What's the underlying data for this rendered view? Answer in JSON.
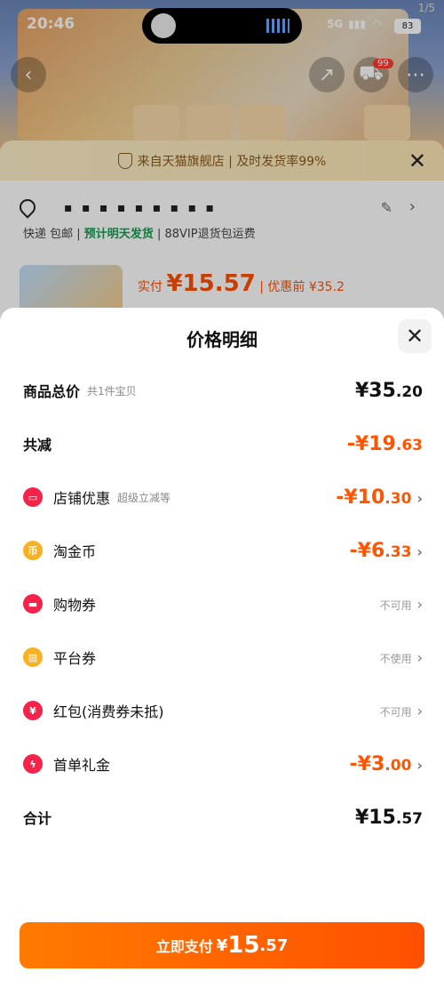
{
  "status": {
    "time": "20:46",
    "network": "5G",
    "battery": "83",
    "pager": "1/5"
  },
  "background": {
    "notice": "来自天猫旗舰店 | 及时发货率99%",
    "address_masked": "▪ ▪ ▪ ▪ ▪ ▪ ▪ ▪ ▪",
    "shipping_prefix": "快递 包邮 |",
    "shipping_green": "预计明天发货",
    "shipping_suffix": "| 88VIP退货包运费",
    "paid_label": "实付",
    "paid_amount": "¥15.57",
    "before_label": "| 优惠前 ¥35.2",
    "cart_badge": "99"
  },
  "sheet": {
    "title": "价格明细",
    "rows": [
      {
        "label": "商品总价",
        "hint": "共1件宝贝",
        "int": "¥35",
        "dec": ".20"
      },
      {
        "label": "共减",
        "int": "-¥19",
        "dec": ".63"
      },
      {
        "label": "店铺优惠",
        "hint": "超级立减等",
        "int": "-¥10",
        "dec": ".30"
      },
      {
        "label": "淘金币",
        "int": "-¥6",
        "dec": ".33"
      },
      {
        "label": "购物券",
        "status": "不可用"
      },
      {
        "label": "平台券",
        "status": "不使用"
      },
      {
        "label": "红包(消费券未抵)",
        "status": "不可用"
      },
      {
        "label": "首单礼金",
        "int": "-¥3",
        "dec": ".00"
      },
      {
        "label": "合计",
        "int": "¥15",
        "dec": ".57"
      }
    ],
    "pay_button": {
      "label": "立即支付",
      "currency": "¥",
      "int": "15",
      "dec": ".57"
    }
  },
  "colors": {
    "accent": "#ff5000",
    "icon_red": "#f5234a",
    "icon_gold": "#f7b224"
  },
  "icons": [
    "location-icon",
    "edit-icon",
    "close-icon",
    "shop-discount-icon",
    "coin-icon",
    "shopping-coupon-icon",
    "platform-coupon-icon",
    "red-packet-icon",
    "lightning-icon",
    "chevron-right-icon"
  ]
}
